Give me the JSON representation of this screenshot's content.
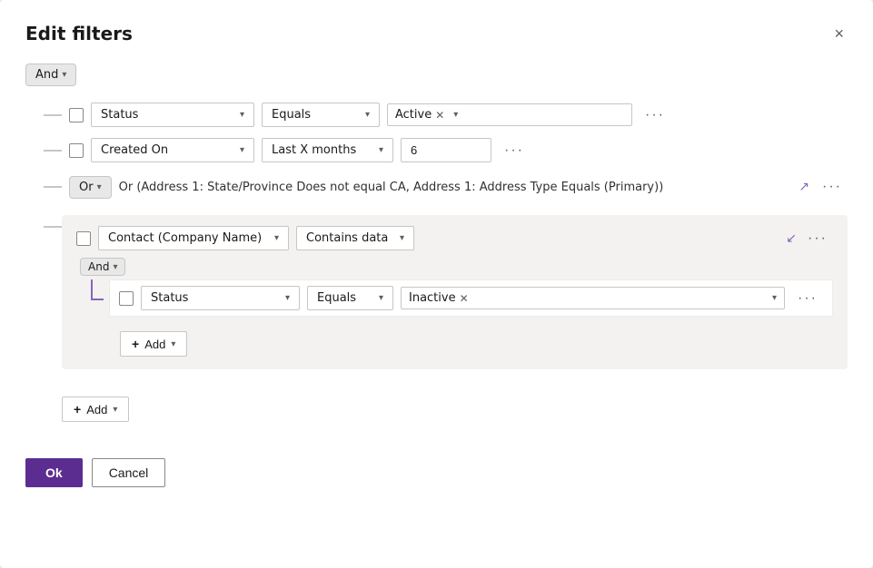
{
  "dialog": {
    "title": "Edit filters",
    "close_label": "×"
  },
  "top_logic": {
    "label": "And",
    "chevron": "▾"
  },
  "rows": [
    {
      "id": "row1",
      "field": "Status",
      "operator": "Equals",
      "value_tag": "Active",
      "value_type": "tag"
    },
    {
      "id": "row2",
      "field": "Created On",
      "operator": "Last X months",
      "value": "6",
      "value_type": "text"
    }
  ],
  "or_group": {
    "logic": "Or",
    "chevron": "▾",
    "text": "Or (Address 1: State/Province Does not equal CA, Address 1: Address Type Equals (Primary))",
    "expand_icon": "↗"
  },
  "nested_group": {
    "field": "Contact (Company Name)",
    "operator": "Contains data",
    "collapse_icon": "↙",
    "inner_logic": "And",
    "inner_logic_chevron": "▾",
    "inner_row": {
      "field": "Status",
      "operator": "Equals",
      "value_tag": "Inactive",
      "value_type": "tag"
    },
    "add_label": "Add",
    "add_plus": "+",
    "add_chevron": "▾"
  },
  "add_outer": {
    "label": "Add",
    "plus": "+",
    "chevron": "▾"
  },
  "footer": {
    "ok_label": "Ok",
    "cancel_label": "Cancel"
  }
}
